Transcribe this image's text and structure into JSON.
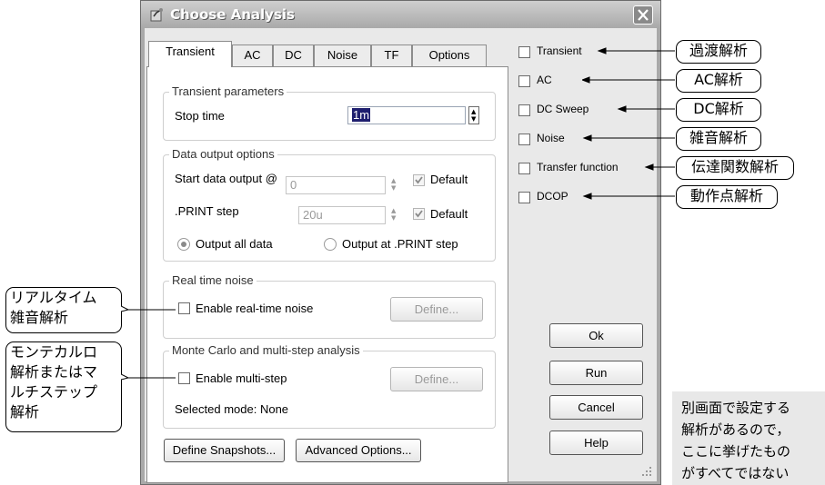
{
  "window": {
    "title": "Choose Analysis"
  },
  "tabs": [
    "Transient",
    "AC",
    "DC",
    "Noise",
    "TF",
    "Options"
  ],
  "transient_params": {
    "title": "Transient parameters",
    "stop_time_label": "Stop time",
    "stop_time_value": "1m"
  },
  "data_output": {
    "title": "Data output options",
    "start_label": "Start data output @",
    "start_value": "0",
    "start_default": "Default",
    "print_label": ".PRINT step",
    "print_value": "20u",
    "print_default": "Default",
    "radio_all": "Output all data",
    "radio_print": "Output at .PRINT step"
  },
  "realtime_noise": {
    "title": "Real time noise",
    "checkbox": "Enable real-time noise",
    "define": "Define..."
  },
  "monte_carlo": {
    "title": "Monte Carlo and multi-step analysis",
    "checkbox": "Enable multi-step",
    "define": "Define...",
    "mode": "Selected mode: None"
  },
  "bottom_buttons": {
    "snapshots": "Define Snapshots...",
    "advanced": "Advanced Options..."
  },
  "analysis_checks": [
    "Transient",
    "AC",
    "DC Sweep",
    "Noise",
    "Transfer function",
    "DCOP"
  ],
  "action_buttons": {
    "ok": "Ok",
    "run": "Run",
    "cancel": "Cancel",
    "help": "Help"
  },
  "callouts": {
    "right": [
      "過渡解析",
      "AC解析",
      "DC解析",
      "雑音解析",
      "伝達関数解析",
      "動作点解析"
    ],
    "left_rt": [
      "リアルタイム",
      "雑音解析"
    ],
    "left_mc": [
      "モンテカルロ",
      "解析またはマ",
      "ルチステップ",
      "解析"
    ]
  },
  "note": [
    "別画面で設定する",
    "解析があるので，",
    "ここに挙げたもの",
    "がすべてではない"
  ],
  "colors": {
    "title_gradient_top": "#cfcfcf",
    "title_gradient_bottom": "#a9a9a9",
    "dialog_bg": "#e9e9e9"
  }
}
